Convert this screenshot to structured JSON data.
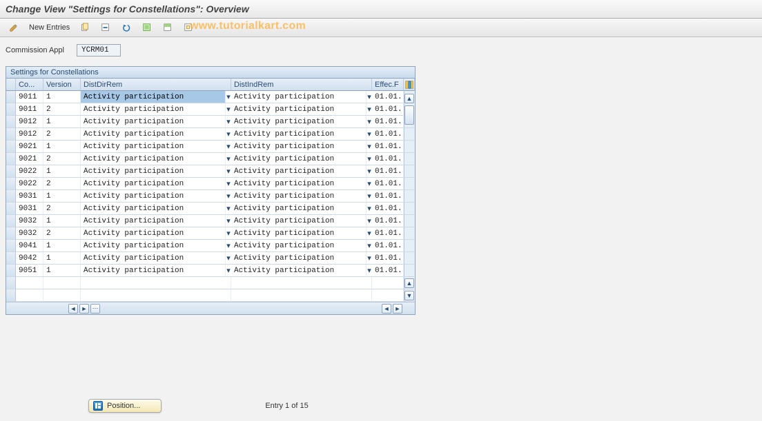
{
  "header": {
    "title": "Change View \"Settings for Constellations\": Overview"
  },
  "toolbar": {
    "new_entries_label": "New Entries",
    "watermark": "www.tutorialkart.com"
  },
  "field": {
    "label": "Commission Appl",
    "value": "YCRM01"
  },
  "table": {
    "title": "Settings for Constellations",
    "columns": {
      "co": "Co...",
      "version": "Version",
      "distdir": "DistDirRem",
      "distind": "DistIndRem",
      "effec": "Effec.F"
    },
    "rows": [
      {
        "co": "9011",
        "ver": "1",
        "dir": "Activity participation",
        "ind": "Activity participation",
        "eff": "01.01.",
        "sel": true
      },
      {
        "co": "9011",
        "ver": "2",
        "dir": "Activity participation",
        "ind": "Activity participation",
        "eff": "01.01."
      },
      {
        "co": "9012",
        "ver": "1",
        "dir": "Activity participation",
        "ind": "Activity participation",
        "eff": "01.01."
      },
      {
        "co": "9012",
        "ver": "2",
        "dir": "Activity participation",
        "ind": "Activity participation",
        "eff": "01.01."
      },
      {
        "co": "9021",
        "ver": "1",
        "dir": "Activity participation",
        "ind": "Activity participation",
        "eff": "01.01."
      },
      {
        "co": "9021",
        "ver": "2",
        "dir": "Activity participation",
        "ind": "Activity participation",
        "eff": "01.01."
      },
      {
        "co": "9022",
        "ver": "1",
        "dir": "Activity participation",
        "ind": "Activity participation",
        "eff": "01.01."
      },
      {
        "co": "9022",
        "ver": "2",
        "dir": "Activity participation",
        "ind": "Activity participation",
        "eff": "01.01."
      },
      {
        "co": "9031",
        "ver": "1",
        "dir": "Activity participation",
        "ind": "Activity participation",
        "eff": "01.01."
      },
      {
        "co": "9031",
        "ver": "2",
        "dir": "Activity participation",
        "ind": "Activity participation",
        "eff": "01.01."
      },
      {
        "co": "9032",
        "ver": "1",
        "dir": "Activity participation",
        "ind": "Activity participation",
        "eff": "01.01."
      },
      {
        "co": "9032",
        "ver": "2",
        "dir": "Activity participation",
        "ind": "Activity participation",
        "eff": "01.01."
      },
      {
        "co": "9041",
        "ver": "1",
        "dir": "Activity participation",
        "ind": "Activity participation",
        "eff": "01.01."
      },
      {
        "co": "9042",
        "ver": "1",
        "dir": "Activity participation",
        "ind": "Activity participation",
        "eff": "01.01."
      },
      {
        "co": "9051",
        "ver": "1",
        "dir": "Activity participation",
        "ind": "Activity participation",
        "eff": "01.01."
      }
    ]
  },
  "footer": {
    "position_label": "Position...",
    "entry_text": "Entry 1 of 15"
  }
}
